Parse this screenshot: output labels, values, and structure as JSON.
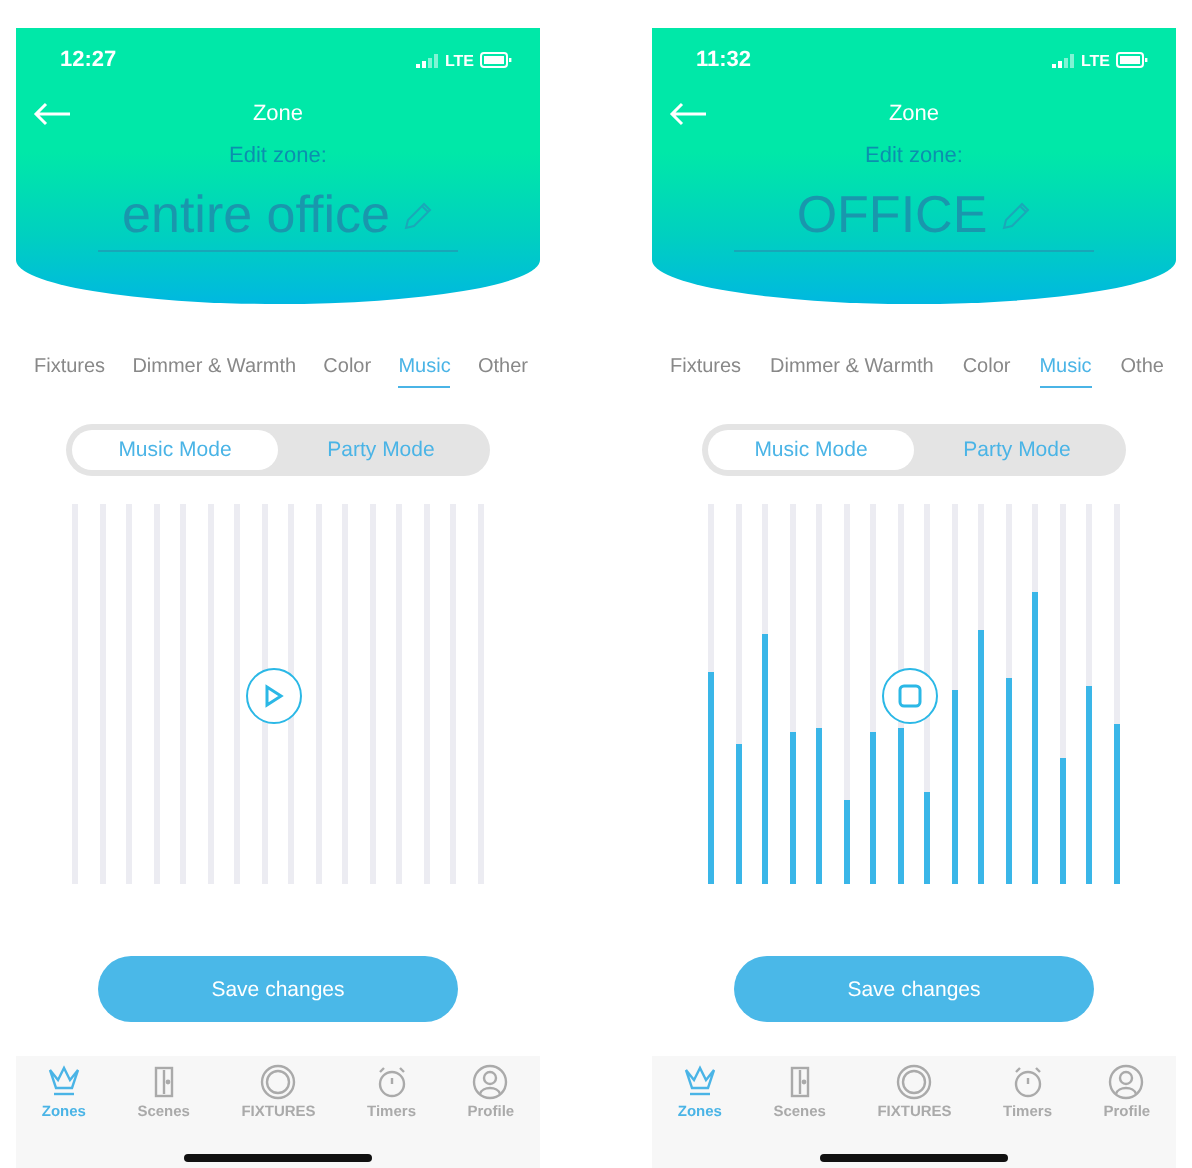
{
  "phones": [
    {
      "status_bar": {
        "time": "12:27",
        "network": "LTE"
      },
      "header": {
        "title": "Zone",
        "subtitle": "Edit zone:",
        "zone_name": "entire office"
      },
      "tabs": [
        {
          "label": "Fixtures",
          "selected": false
        },
        {
          "label": "Dimmer & Warmth",
          "selected": false
        },
        {
          "label": "Color",
          "selected": false
        },
        {
          "label": "Music",
          "selected": true
        },
        {
          "label": "Other",
          "selected": false
        }
      ],
      "mode_toggle": [
        {
          "label": "Music Mode",
          "selected": true
        },
        {
          "label": "Party Mode",
          "selected": false
        }
      ],
      "visualizer": {
        "playing": false,
        "bars": [
          {
            "level": 0
          },
          {
            "level": 0
          },
          {
            "level": 0
          },
          {
            "level": 0
          },
          {
            "level": 0
          },
          {
            "level": 0
          },
          {
            "level": 0
          },
          {
            "level": 0
          },
          {
            "level": 0
          },
          {
            "level": 0
          },
          {
            "level": 0
          },
          {
            "level": 0
          },
          {
            "level": 0
          },
          {
            "level": 0
          },
          {
            "level": 0
          },
          {
            "level": 0
          }
        ]
      },
      "save_button": "Save changes",
      "nav": [
        {
          "label": "Zones",
          "selected": true
        },
        {
          "label": "Scenes",
          "selected": false
        },
        {
          "label": "FIXTURES",
          "selected": false
        },
        {
          "label": "Timers",
          "selected": false
        },
        {
          "label": "Profile",
          "selected": false
        }
      ]
    },
    {
      "status_bar": {
        "time": "11:32",
        "network": "LTE"
      },
      "header": {
        "title": "Zone",
        "subtitle": "Edit zone:",
        "zone_name": "OFFICE"
      },
      "tabs": [
        {
          "label": "Fixtures",
          "selected": false
        },
        {
          "label": "Dimmer & Warmth",
          "selected": false
        },
        {
          "label": "Color",
          "selected": false
        },
        {
          "label": "Music",
          "selected": true
        },
        {
          "label": "Othe",
          "selected": false
        }
      ],
      "mode_toggle": [
        {
          "label": "Music Mode",
          "selected": true
        },
        {
          "label": "Party Mode",
          "selected": false
        }
      ],
      "visualizer": {
        "playing": true,
        "bars": [
          {
            "level": 0.56
          },
          {
            "level": 0.37
          },
          {
            "level": 0.66
          },
          {
            "level": 0.4
          },
          {
            "level": 0.41
          },
          {
            "level": 0.22
          },
          {
            "level": 0.4
          },
          {
            "level": 0.41
          },
          {
            "level": 0.24
          },
          {
            "level": 0.51
          },
          {
            "level": 0.67
          },
          {
            "level": 0.54
          },
          {
            "level": 0.77
          },
          {
            "level": 0.33
          },
          {
            "level": 0.52
          },
          {
            "level": 0.42
          }
        ]
      },
      "save_button": "Save changes",
      "nav": [
        {
          "label": "Zones",
          "selected": true
        },
        {
          "label": "Scenes",
          "selected": false
        },
        {
          "label": "FIXTURES",
          "selected": false
        },
        {
          "label": "Timers",
          "selected": false
        },
        {
          "label": "Profile",
          "selected": false
        }
      ]
    }
  ]
}
